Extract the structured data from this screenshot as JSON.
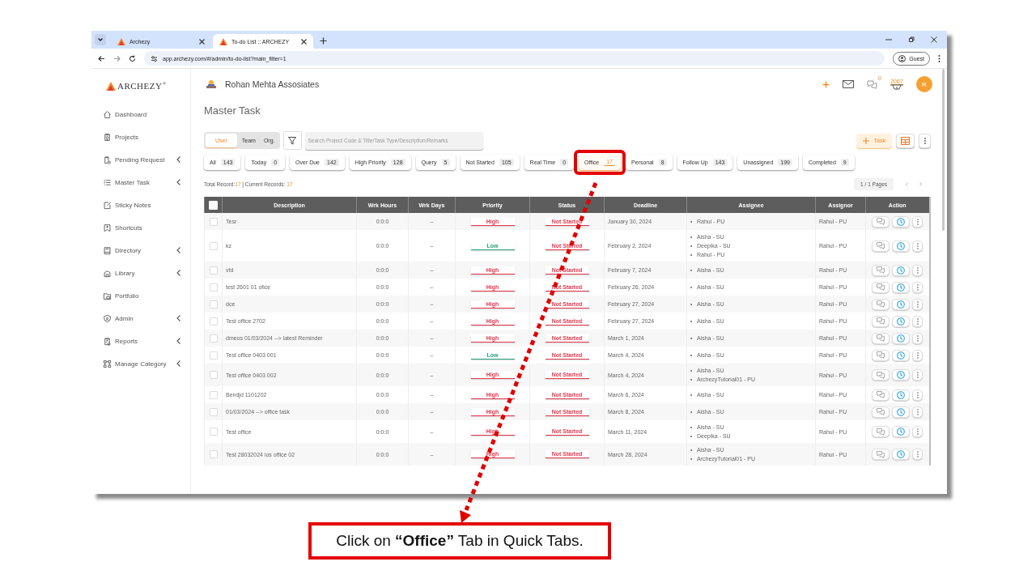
{
  "browser": {
    "tabs": [
      {
        "title": "Archezy",
        "selected": false
      },
      {
        "title": "To-do List :: ARCHEZY",
        "selected": true
      }
    ],
    "url": "app.archezy.com/#/admin/to-do-list?main_filter=1",
    "profile": "Guest"
  },
  "app": {
    "logo": "ARCHEZY",
    "logo_mark": "®",
    "company": "Rohan Mehta Assosiates",
    "messages": "0",
    "points": "2067",
    "avatar": "R"
  },
  "sidebar": {
    "items": [
      {
        "label": "Dashboard",
        "has_submenu": false
      },
      {
        "label": "Projects",
        "has_submenu": false
      },
      {
        "label": "Pending Request",
        "has_submenu": true
      },
      {
        "label": "Master Task",
        "has_submenu": true
      },
      {
        "label": "Sticky Notes",
        "has_submenu": false
      },
      {
        "label": "Shortcuts",
        "has_submenu": false
      },
      {
        "label": "Directory",
        "has_submenu": true
      },
      {
        "label": "Library",
        "has_submenu": true
      },
      {
        "label": "Portfolio",
        "has_submenu": false
      },
      {
        "label": "Admin",
        "has_submenu": true
      },
      {
        "label": "Reports",
        "has_submenu": true
      },
      {
        "label": "Manage Category",
        "has_submenu": true
      }
    ]
  },
  "page_title": "Master Task",
  "scope_tabs": [
    {
      "label": "User",
      "selected": true
    },
    {
      "label": "Team",
      "selected": false
    },
    {
      "label": "Org.",
      "selected": false
    }
  ],
  "search": {
    "placeholder": "Search Project Code & Title/Task Type/Description/Remarks"
  },
  "add_button": "Task",
  "quick_tabs": [
    {
      "label": "All",
      "count": "143",
      "selected": false,
      "highlighted": false
    },
    {
      "label": "Today",
      "count": "0",
      "selected": false,
      "highlighted": false
    },
    {
      "label": "Over Due",
      "count": "142",
      "selected": false,
      "highlighted": false
    },
    {
      "label": "High Priority",
      "count": "128",
      "selected": false,
      "highlighted": false
    },
    {
      "label": "Query",
      "count": "5",
      "selected": false,
      "highlighted": false
    },
    {
      "label": "Not Started",
      "count": "105",
      "selected": false,
      "highlighted": false
    },
    {
      "label": "Real Time",
      "count": "0",
      "selected": false,
      "highlighted": false
    },
    {
      "label": "Office",
      "count": "17",
      "selected": true,
      "highlighted": true
    },
    {
      "label": "Personal",
      "count": "8",
      "selected": false,
      "highlighted": false
    },
    {
      "label": "Follow Up",
      "count": "143",
      "selected": false,
      "highlighted": false
    },
    {
      "label": "Unassigned",
      "count": "199",
      "selected": false,
      "highlighted": false
    },
    {
      "label": "Completed",
      "count": "9",
      "selected": false,
      "highlighted": false
    }
  ],
  "records": {
    "total_label": "Total Record:",
    "total": "17",
    "current_label": "| Current Records:",
    "current": "17"
  },
  "pagination": "1 / 1 Pages",
  "table": {
    "select_all_checked": false,
    "columns": [
      "Description",
      "Wrk Hours",
      "Wrk Days",
      "Priority",
      "Status",
      "Deadline",
      "Assignee",
      "Assignor",
      "Action"
    ],
    "rows": [
      {
        "checked": false,
        "description": "Tesr",
        "wrk_hours": "0:0:0",
        "wrk_days": "–",
        "priority": {
          "label": "High",
          "kind": "high"
        },
        "status": {
          "label": "Not Started",
          "kind": "not_started"
        },
        "deadline": "January 30, 2024",
        "assignees": [
          "Rahul - PU"
        ],
        "assignor": "Rahul - PU"
      },
      {
        "checked": false,
        "description": "kz",
        "wrk_hours": "0:0:0",
        "wrk_days": "–",
        "priority": {
          "label": "Low",
          "kind": "low"
        },
        "status": {
          "label": "Not Started",
          "kind": "not_started"
        },
        "deadline": "February 2, 2024",
        "assignees": [
          "Aisha - SU",
          "Deepika - SU",
          "Rahul - PU"
        ],
        "assignor": "Rahul - PU"
      },
      {
        "checked": false,
        "description": "vfd",
        "wrk_hours": "0:0:0",
        "wrk_days": "–",
        "priority": {
          "label": "High",
          "kind": "high"
        },
        "status": {
          "label": "Not Started",
          "kind": "not_started"
        },
        "deadline": "February 7, 2024",
        "assignees": [
          "Aisha - SU"
        ],
        "assignor": "Rahul - PU"
      },
      {
        "checked": false,
        "description": "test 2601 01 ofice",
        "wrk_hours": "0:0:0",
        "wrk_days": "–",
        "priority": {
          "label": "High",
          "kind": "high"
        },
        "status": {
          "label": "Not Started",
          "kind": "not_started"
        },
        "deadline": "February 26, 2024",
        "assignees": [
          "Aisha - SU"
        ],
        "assignor": "Rahul - PU"
      },
      {
        "checked": false,
        "description": "dce",
        "wrk_hours": "0:0:0",
        "wrk_days": "–",
        "priority": {
          "label": "High",
          "kind": "high"
        },
        "status": {
          "label": "Not Started",
          "kind": "not_started"
        },
        "deadline": "February 27, 2024",
        "assignees": [
          "Aisha - SU"
        ],
        "assignor": "Rahul - PU"
      },
      {
        "checked": false,
        "description": "Test office 2702",
        "wrk_hours": "0:0:0",
        "wrk_days": "–",
        "priority": {
          "label": "High",
          "kind": "high"
        },
        "status": {
          "label": "Not Started",
          "kind": "not_started"
        },
        "deadline": "February 27, 2024",
        "assignees": [
          "Aisha - SU"
        ],
        "assignor": "Rahul - PU"
      },
      {
        "checked": false,
        "description": "dmeos 01/03/2024 --> latest Reminder",
        "wrk_hours": "0:0:0",
        "wrk_days": "–",
        "priority": {
          "label": "High",
          "kind": "high"
        },
        "status": {
          "label": "Not Started",
          "kind": "not_started"
        },
        "deadline": "March 1, 2024",
        "assignees": [
          "Aisha - SU"
        ],
        "assignor": "Rahul - PU"
      },
      {
        "checked": false,
        "description": "Test office 0403 001",
        "wrk_hours": "0:0:0",
        "wrk_days": "–",
        "priority": {
          "label": "Low",
          "kind": "low"
        },
        "status": {
          "label": "Not Started",
          "kind": "not_started"
        },
        "deadline": "March 4, 2024",
        "assignees": [
          "Aisha - SU"
        ],
        "assignor": "Rahul - PU"
      },
      {
        "checked": false,
        "description": "Test office 0403 002",
        "wrk_hours": "0:0:0",
        "wrk_days": "–",
        "priority": {
          "label": "High",
          "kind": "high"
        },
        "status": {
          "label": "Not Started",
          "kind": "not_started"
        },
        "deadline": "March 4, 2024",
        "assignees": [
          "Aisha - SU",
          "ArchezyTutorial01 - PU"
        ],
        "assignor": "Rahul - PU"
      },
      {
        "checked": false,
        "description": "Bendjd 1101202",
        "wrk_hours": "0:0:0",
        "wrk_days": "–",
        "priority": {
          "label": "High",
          "kind": "high"
        },
        "status": {
          "label": "Not Started",
          "kind": "not_started"
        },
        "deadline": "March 6, 2024",
        "assignees": [
          "Aisha - SU"
        ],
        "assignor": "Rahul - PU"
      },
      {
        "checked": false,
        "description": "01/03/2024 --> office task",
        "wrk_hours": "0:0:0",
        "wrk_days": "–",
        "priority": {
          "label": "High",
          "kind": "high"
        },
        "status": {
          "label": "Not Started",
          "kind": "not_started"
        },
        "deadline": "March 8, 2024",
        "assignees": [
          "Aisha - SU"
        ],
        "assignor": "Rahul - PU"
      },
      {
        "checked": false,
        "description": "Test office",
        "wrk_hours": "0:0:0",
        "wrk_days": "–",
        "priority": {
          "label": "High",
          "kind": "high"
        },
        "status": {
          "label": "Not Started",
          "kind": "not_started"
        },
        "deadline": "March 11, 2024",
        "assignees": [
          "Aisha - SU",
          "Deepika - SU"
        ],
        "assignor": "Rahul - PU"
      },
      {
        "checked": false,
        "description": "Test 28032024 ios office 02",
        "wrk_hours": "0:0:0",
        "wrk_days": "–",
        "priority": {
          "label": "High",
          "kind": "high"
        },
        "status": {
          "label": "Not Started",
          "kind": "not_started"
        },
        "deadline": "March 28, 2024",
        "assignees": [
          "Aisha - SU",
          "ArchezyTutorial01 - PU"
        ],
        "assignor": "Rahul - PU"
      }
    ]
  },
  "callout": "Click on **“Office”** Tab in Quick Tabs."
}
